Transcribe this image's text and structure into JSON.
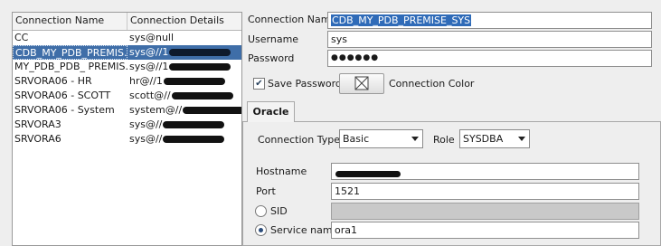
{
  "list": {
    "headers": {
      "name": "Connection Name",
      "details": "Connection Details"
    },
    "rows": [
      {
        "name": "CC",
        "details": "sys@null",
        "redacted": false,
        "selected": false
      },
      {
        "name": "CDB_MY_PDB_PREMIS...",
        "details": "sys@//1",
        "redacted": true,
        "selected": true
      },
      {
        "name": "MY_PDB_PDB_ PREMIS...",
        "details": "sys@//1",
        "redacted": true,
        "selected": false
      },
      {
        "name": "SRVORA06 - HR",
        "details": "hr@//1",
        "redacted": true,
        "selected": false
      },
      {
        "name": "SRVORA06 - SCOTT",
        "details": "scott@//",
        "redacted": true,
        "selected": false
      },
      {
        "name": "SRVORA06 - System",
        "details": "system@//",
        "redacted": true,
        "selected": false
      },
      {
        "name": "SRVORA3",
        "details": "sys@//",
        "redacted": true,
        "selected": false
      },
      {
        "name": "SRVORA6",
        "details": "sys@//",
        "redacted": true,
        "selected": false
      }
    ]
  },
  "form": {
    "connection_name_label": "Connection Name",
    "connection_name_value": "CDB_MY_PDB_PREMISE_SYS",
    "username_label": "Username",
    "username_value": "sys",
    "password_label": "Password",
    "password_value": "●●●●●●",
    "save_password_label": "Save Password",
    "save_password_checked": true,
    "connection_color_label": "Connection Color"
  },
  "oracle": {
    "tab_label": "Oracle",
    "connection_type_label": "Connection Type",
    "connection_type_value": "Basic",
    "role_label": "Role",
    "role_value": "SYSDBA",
    "hostname_label": "Hostname",
    "hostname_redacted": true,
    "port_label": "Port",
    "port_value": "1521",
    "sid_label": "SID",
    "sid_selected": false,
    "service_name_label": "Service name",
    "service_name_value": "ora1",
    "service_name_selected": true
  },
  "colors": {
    "selection": "#3f6ea8",
    "text_selection": "#2f6bb8",
    "redaction": "#121212"
  }
}
